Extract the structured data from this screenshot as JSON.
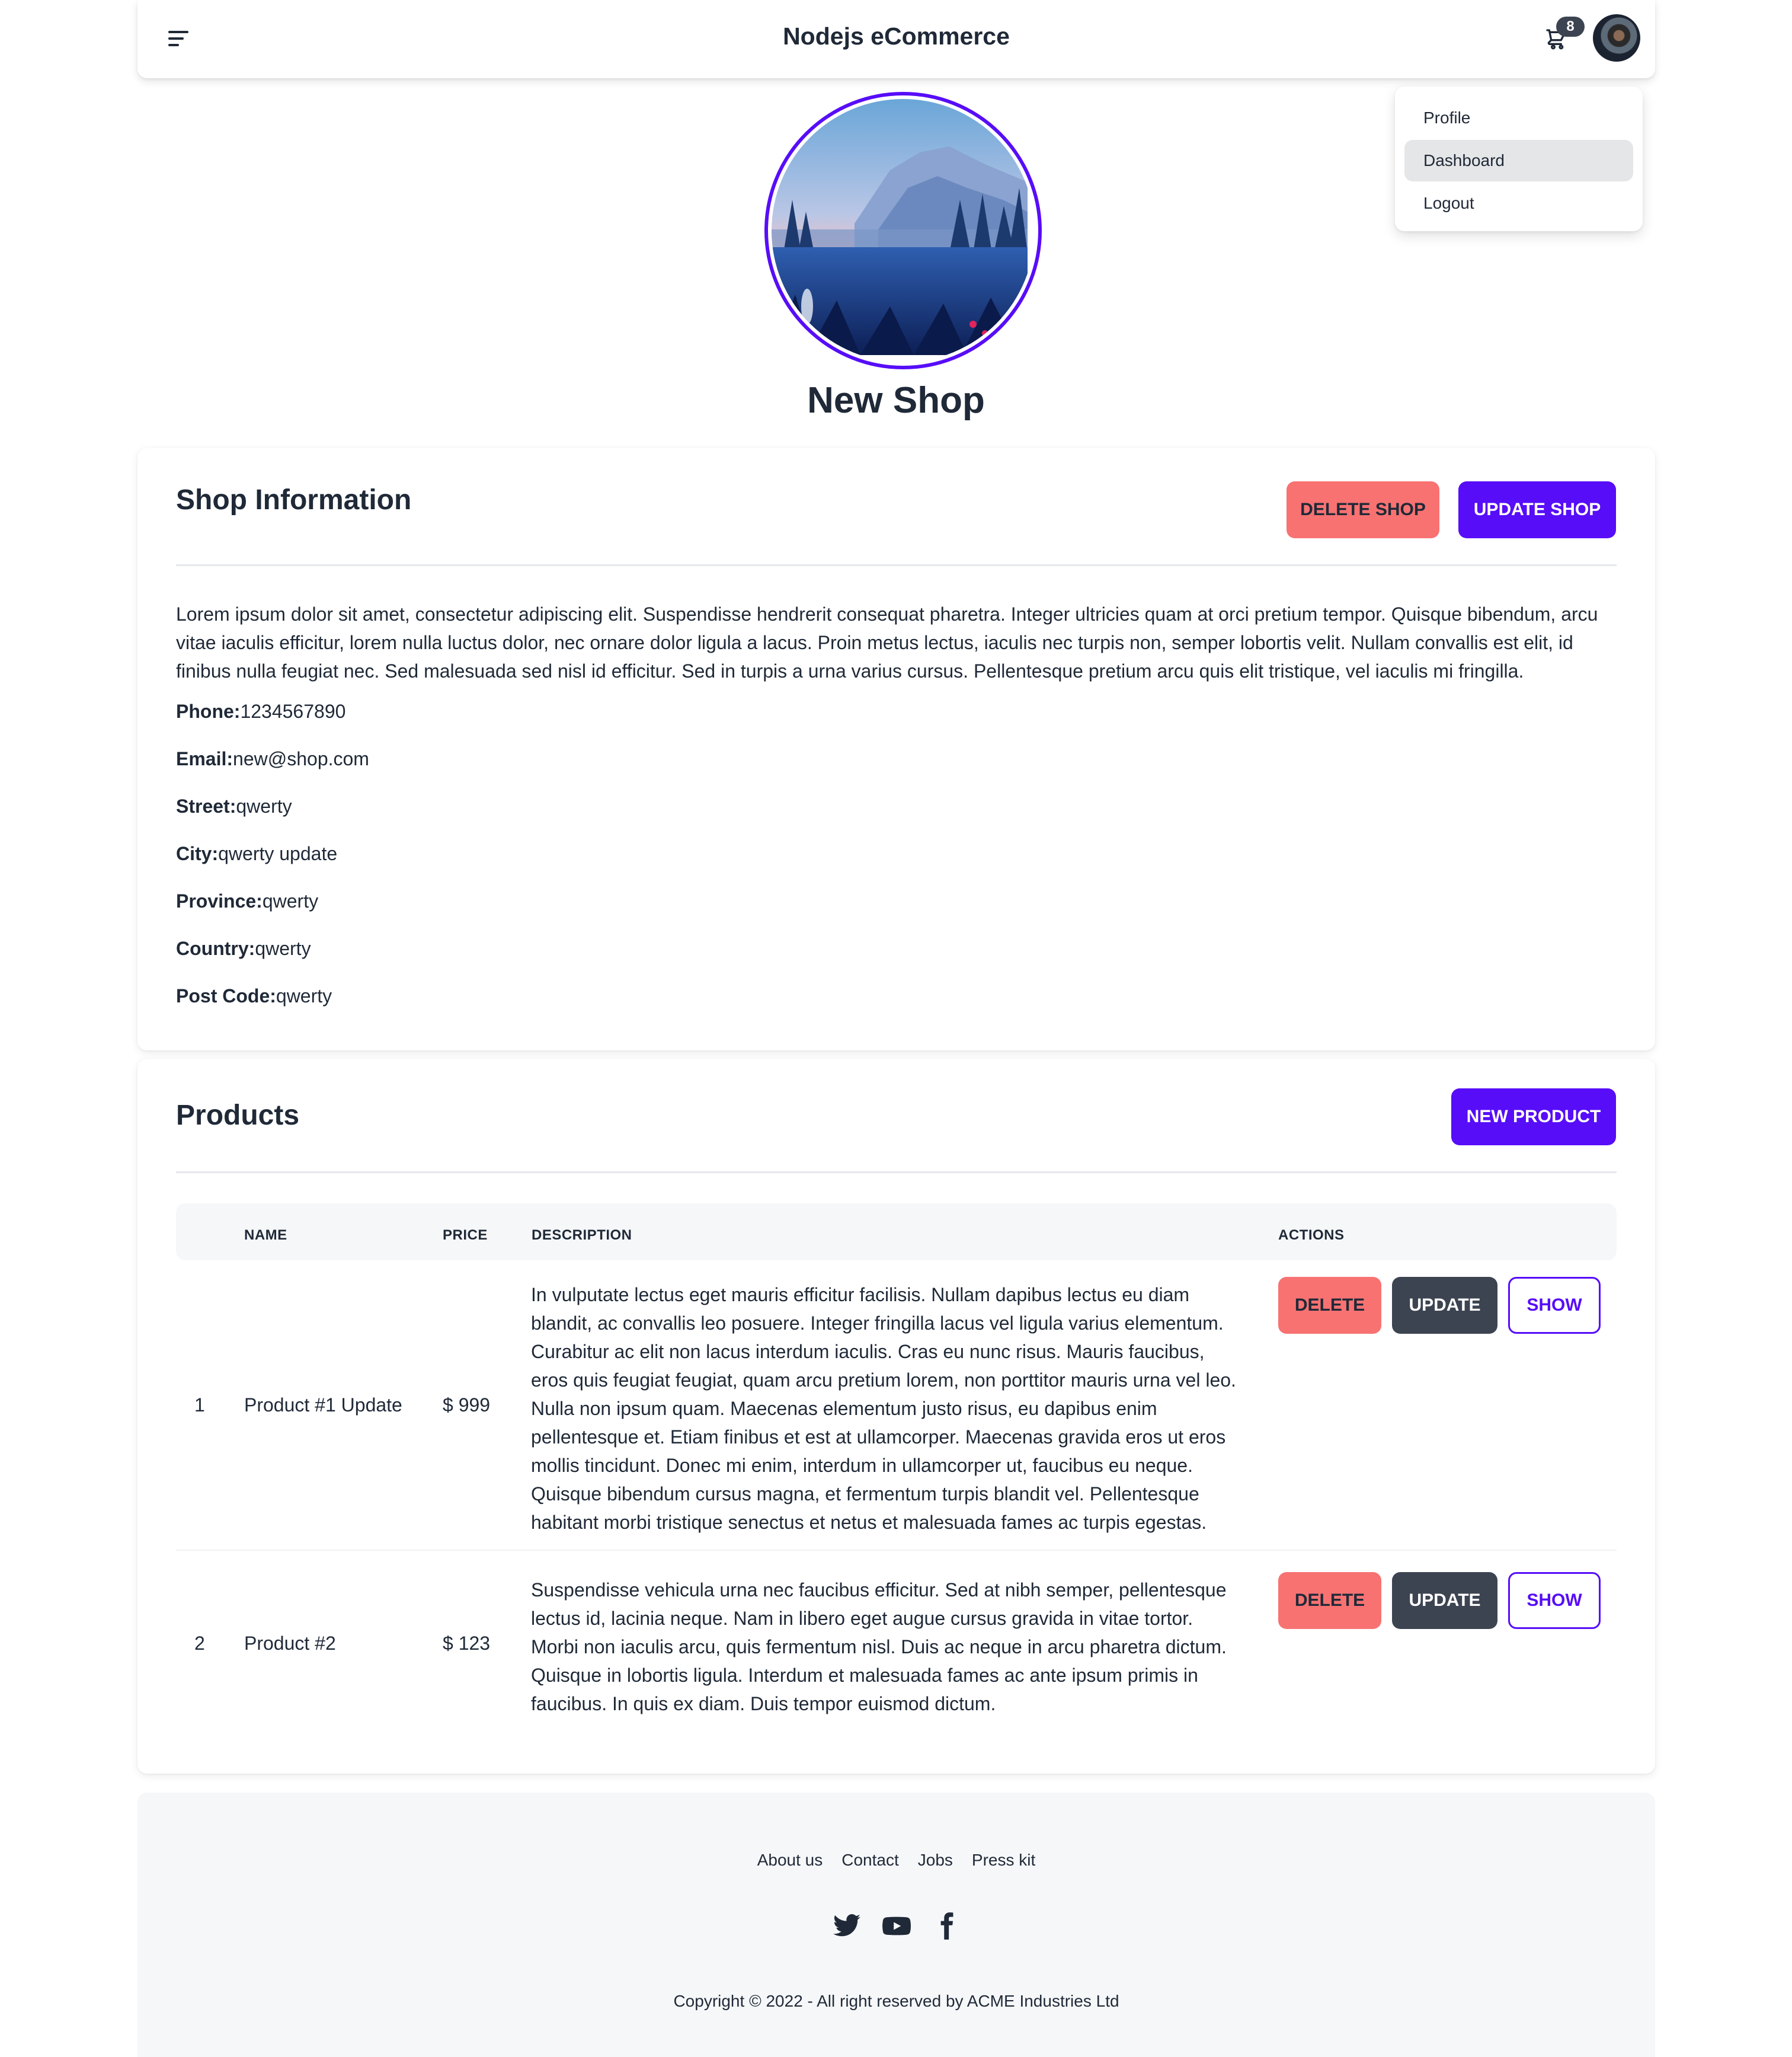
{
  "navbar": {
    "title": "Nodejs eCommerce",
    "menu_icon": "menu-icon",
    "cart_icon": "cart-icon",
    "cart_count": "8"
  },
  "user_menu": {
    "items": [
      "Profile",
      "Dashboard",
      "Logout"
    ],
    "active": "Dashboard"
  },
  "shop": {
    "name": "New Shop"
  },
  "shop_info": {
    "title": "Shop Information",
    "delete_label": "DELETE SHOP",
    "update_label": "UPDATE SHOP",
    "description": "Lorem ipsum dolor sit amet, consectetur adipiscing elit. Suspendisse hendrerit consequat pharetra. Integer ultricies quam at orci pretium tempor. Quisque bibendum, arcu vitae iaculis efficitur, lorem nulla luctus dolor, nec ornare dolor ligula a lacus. Proin metus lectus, iaculis nec turpis non, semper lobortis velit. Nullam convallis est elit, id finibus nulla feugiat nec. Sed malesuada sed nisl id efficitur. Sed in turpis a urna varius cursus. Pellentesque pretium arcu quis elit tristique, vel iaculis mi fringilla.",
    "fields": [
      {
        "label": "Phone:",
        "value": "1234567890"
      },
      {
        "label": "Email:",
        "value": "new@shop.com"
      },
      {
        "label": "Street:",
        "value": "qwerty"
      },
      {
        "label": "City:",
        "value": "qwerty update"
      },
      {
        "label": "Province:",
        "value": "qwerty"
      },
      {
        "label": "Country:",
        "value": "qwerty"
      },
      {
        "label": "Post Code:",
        "value": "qwerty"
      }
    ]
  },
  "products": {
    "title": "Products",
    "new_label": "NEW PRODUCT",
    "headers": [
      "NAME",
      "PRICE",
      "DESCRIPTION",
      "ACTIONS"
    ],
    "action_labels": [
      "DELETE",
      "UPDATE",
      "SHOW"
    ],
    "rows": [
      {
        "index": "1",
        "name": "Product #1 Update",
        "price": "$ 999",
        "description": "In vulputate lectus eget mauris efficitur facilisis. Nullam dapibus lectus eu diam blandit, ac convallis leo posuere. Integer fringilla lacus vel ligula varius elementum. Curabitur ac elit non lacus interdum iaculis. Cras eu nunc risus. Mauris faucibus, eros quis feugiat feugiat, quam arcu pretium lorem, non porttitor mauris urna vel leo. Nulla non ipsum quam. Maecenas elementum justo risus, eu dapibus enim pellentesque et. Etiam finibus et est at ullamcorper. Maecenas gravida eros ut eros mollis tincidunt. Donec mi enim, interdum in ullamcorper ut, faucibus eu neque. Quisque bibendum cursus magna, et fermentum turpis blandit vel. Pellentesque habitant morbi tristique senectus et netus et malesuada fames ac turpis egestas."
      },
      {
        "index": "2",
        "name": "Product #2",
        "price": "$ 123",
        "description": "Suspendisse vehicula urna nec faucibus efficitur. Sed at nibh semper, pellentesque lectus id, lacinia neque. Nam in libero eget augue cursus gravida in vitae tortor. Morbi non iaculis arcu, quis fermentum nisl. Duis ac neque in arcu pharetra dictum. Quisque in lobortis ligula. Interdum et malesuada fames ac ante ipsum primis in faucibus. In quis ex diam. Duis tempor euismod dictum."
      }
    ]
  },
  "footer": {
    "links": [
      "About us",
      "Contact",
      "Jobs",
      "Press kit"
    ],
    "socials": [
      "twitter-icon",
      "youtube-icon",
      "facebook-icon"
    ],
    "copyright": "Copyright © 2022 - All right reserved by ACME Industries Ltd"
  },
  "colors": {
    "primary": "#570df8",
    "error": "#f87272",
    "neutral": "#3d4451"
  }
}
